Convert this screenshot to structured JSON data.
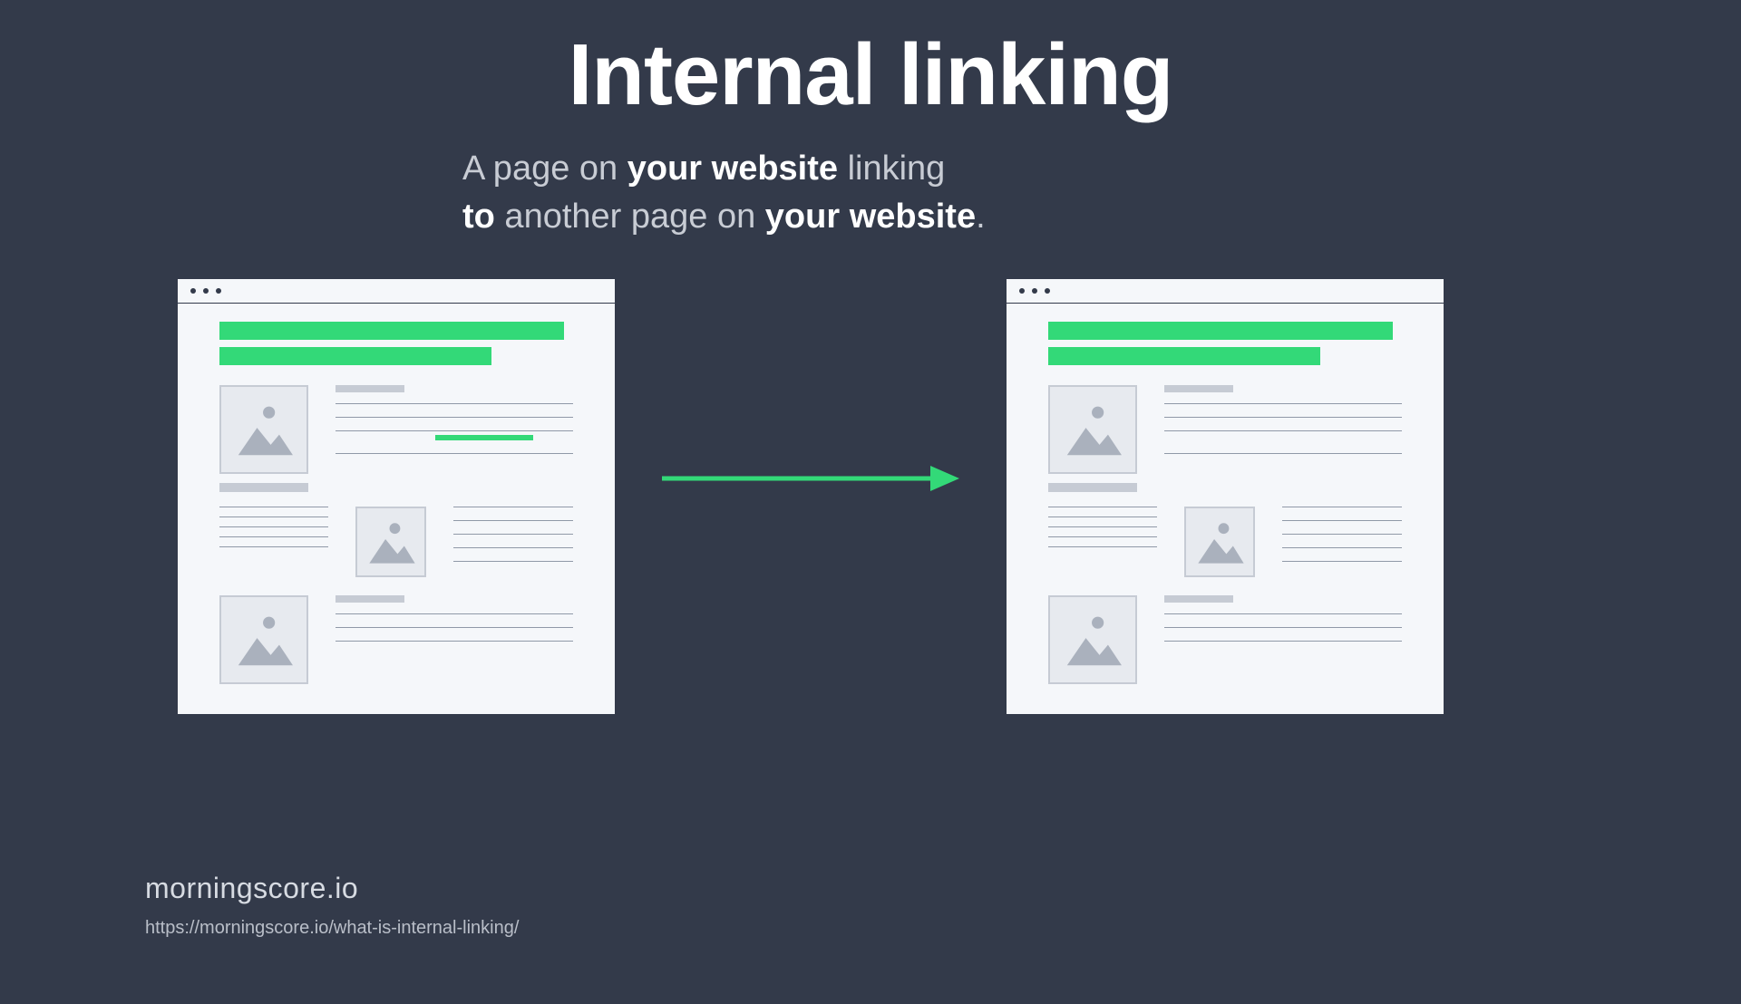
{
  "title": "Internal linking",
  "subtitle": {
    "p1": "A page on ",
    "b1": "your website",
    "p2": " linking",
    "b2": "to",
    "p3": " another page on ",
    "b3": "your website",
    "p4": "."
  },
  "colors": {
    "background": "#333a4a",
    "accent_green": "#33d978",
    "page_bg": "#f5f7fa",
    "placeholder_gray": "#c6cbd4"
  },
  "footer": {
    "brand": "morningscore.io",
    "url": "https://morningscore.io/what-is-internal-linking/"
  }
}
